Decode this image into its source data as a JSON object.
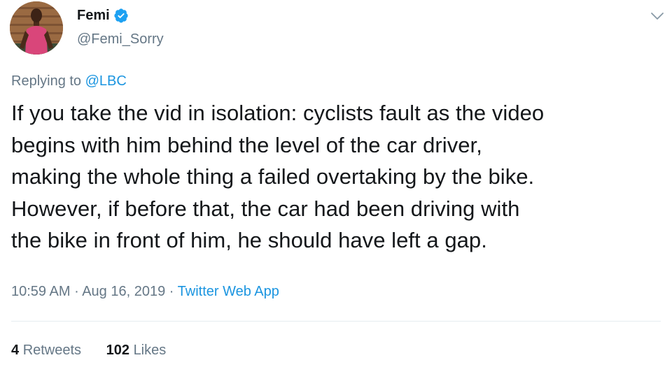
{
  "user": {
    "display_name": "Femi",
    "handle": "@Femi_Sorry",
    "verified": true,
    "avatar_icon": "avatar"
  },
  "reply": {
    "prefix": "Replying to",
    "to": "@LBC"
  },
  "tweet": {
    "lines": [
      "If you take the vid in isolation: cyclists fault as the video",
      "begins with him behind the level of the car driver,",
      "making the whole thing a failed overtaking by the bike.",
      "However, if before that, the car had been driving with",
      "the bike in front of him, he should have left a gap."
    ]
  },
  "meta": {
    "time": "10:59 AM",
    "sep1": "·",
    "date": "Aug 16, 2019",
    "sep2": "·",
    "app": "Twitter Web App"
  },
  "stats": {
    "retweets_count": "4",
    "retweets_label": "Retweets",
    "likes_count": "102",
    "likes_label": "Likes"
  },
  "colors": {
    "link": "#1b95e0",
    "secondary_text": "#657786",
    "verified_badge": "#1da1f2",
    "primary_text": "#14171a"
  }
}
